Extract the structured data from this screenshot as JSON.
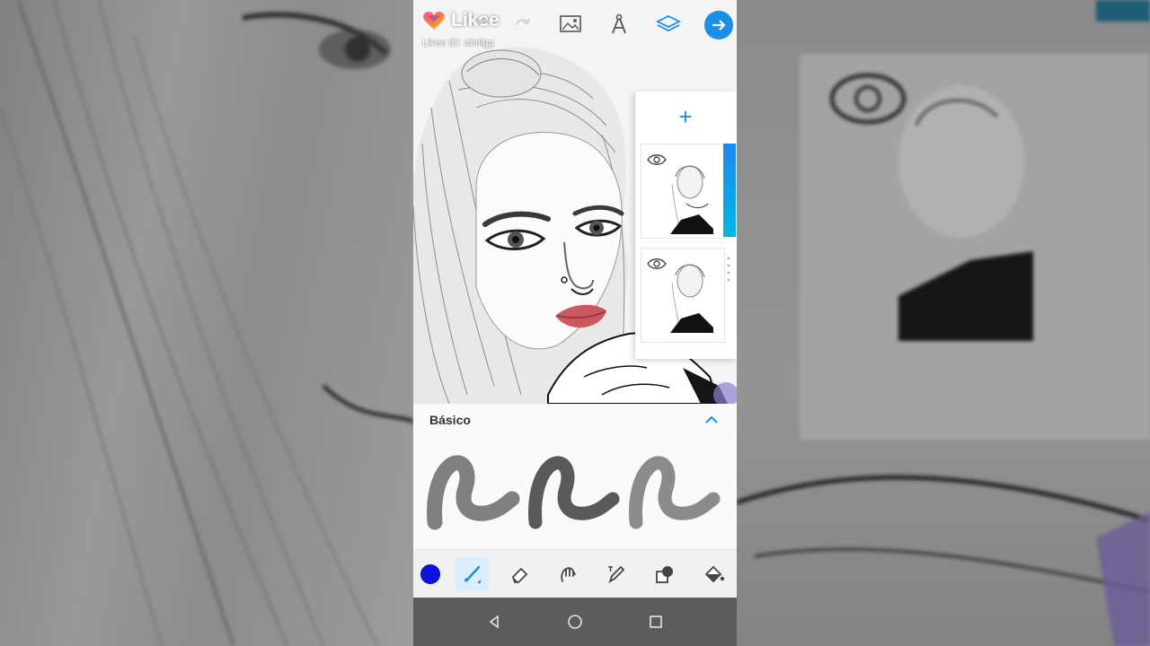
{
  "watermark": {
    "brand": "Likee",
    "user_id": "Likee ID: abrilgg"
  },
  "toolbar": {
    "icons": [
      "undo-icon",
      "redo-icon",
      "image-icon",
      "ruler-icon",
      "layers-icon",
      "next-icon"
    ],
    "next_color": "#1a8fe3"
  },
  "layers": {
    "add_symbol": "+",
    "items": [
      "layer-1",
      "layer-2"
    ],
    "active_index": 0
  },
  "brush_panel": {
    "title": "Básico",
    "brushes": [
      "brush-1",
      "brush-2",
      "brush-3"
    ]
  },
  "tools": {
    "current_color": "#1010e0",
    "items": [
      "color-picker",
      "brush-tool",
      "eraser-tool",
      "smudge-tool",
      "pen-tool",
      "layer-copy-tool",
      "fill-tool"
    ],
    "active": "brush-tool"
  },
  "nav": {
    "buttons": [
      "back-icon",
      "home-icon",
      "recents-icon"
    ]
  },
  "colors": {
    "accent": "#1a8fe3",
    "navbar": "#5a5c5e",
    "lips": "#c9595f"
  }
}
